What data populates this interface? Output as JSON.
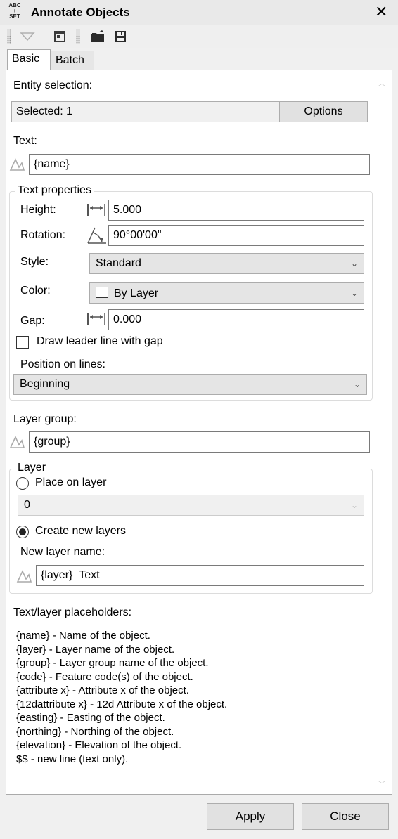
{
  "window": {
    "title": "Annotate Objects",
    "app_icon_lines": [
      "ABC",
      "+",
      "SET"
    ],
    "close_glyph": "✕",
    "close_icon": "close-icon"
  },
  "toolbar": {
    "icons": [
      "dropdown-triangle-icon",
      "window-icon",
      "open-folder-icon",
      "save-icon"
    ]
  },
  "tabs": [
    {
      "label": "Basic",
      "active": true
    },
    {
      "label": "Batch",
      "active": false
    }
  ],
  "entity_selection": {
    "label": "Entity selection:",
    "value": "Selected: 1",
    "options_button": "Options"
  },
  "text": {
    "label": "Text:",
    "value": "{name}",
    "icon": "text-placeholder-icon"
  },
  "text_properties": {
    "legend": "Text properties",
    "height": {
      "label": "Height:",
      "value": "5.000",
      "icon": "dimension-icon"
    },
    "rotation": {
      "label": "Rotation:",
      "value": "90°00'00\"",
      "icon": "angle-icon"
    },
    "style": {
      "label": "Style:",
      "value": "Standard"
    },
    "color": {
      "label": "Color:",
      "value": "By Layer",
      "swatch": "#ffffff"
    },
    "gap": {
      "label": "Gap:",
      "value": "0.000",
      "icon": "dimension-icon"
    },
    "draw_leader": {
      "label": "Draw leader line with gap",
      "checked": false
    },
    "position": {
      "label": "Position on lines:",
      "value": "Beginning"
    }
  },
  "layer_group": {
    "label": "Layer group:",
    "value": "{group}",
    "icon": "text-placeholder-icon"
  },
  "layer": {
    "legend": "Layer",
    "place_on_layer": {
      "label": "Place on layer",
      "selected": false
    },
    "layer_select": {
      "value": "0"
    },
    "create_new_layers": {
      "label": "Create new layers",
      "selected": true
    },
    "new_layer_name": {
      "label": "New layer name:",
      "value": "{layer}_Text",
      "icon": "text-placeholder-icon"
    }
  },
  "placeholders": {
    "label": "Text/layer placeholders:",
    "lines": [
      "{name} - Name of the object.",
      "{layer} - Layer name of the object.",
      "{group} - Layer group name of the object.",
      "{code} - Feature code(s) of the object.",
      "{attribute x} - Attribute x of the object.",
      "{12dattribute x} - 12d Attribute x of the object.",
      "{easting} - Easting of the object.",
      "{northing} - Northing of the object.",
      "{elevation} - Elevation of the object.",
      "$$ - new line (text only)."
    ]
  },
  "footer": {
    "apply": "Apply",
    "close": "Close"
  },
  "colors": {
    "window_bg": "#f0f0f0",
    "panel_bg": "#ffffff",
    "button_bg": "#e1e1e1",
    "border": "#adadad"
  }
}
